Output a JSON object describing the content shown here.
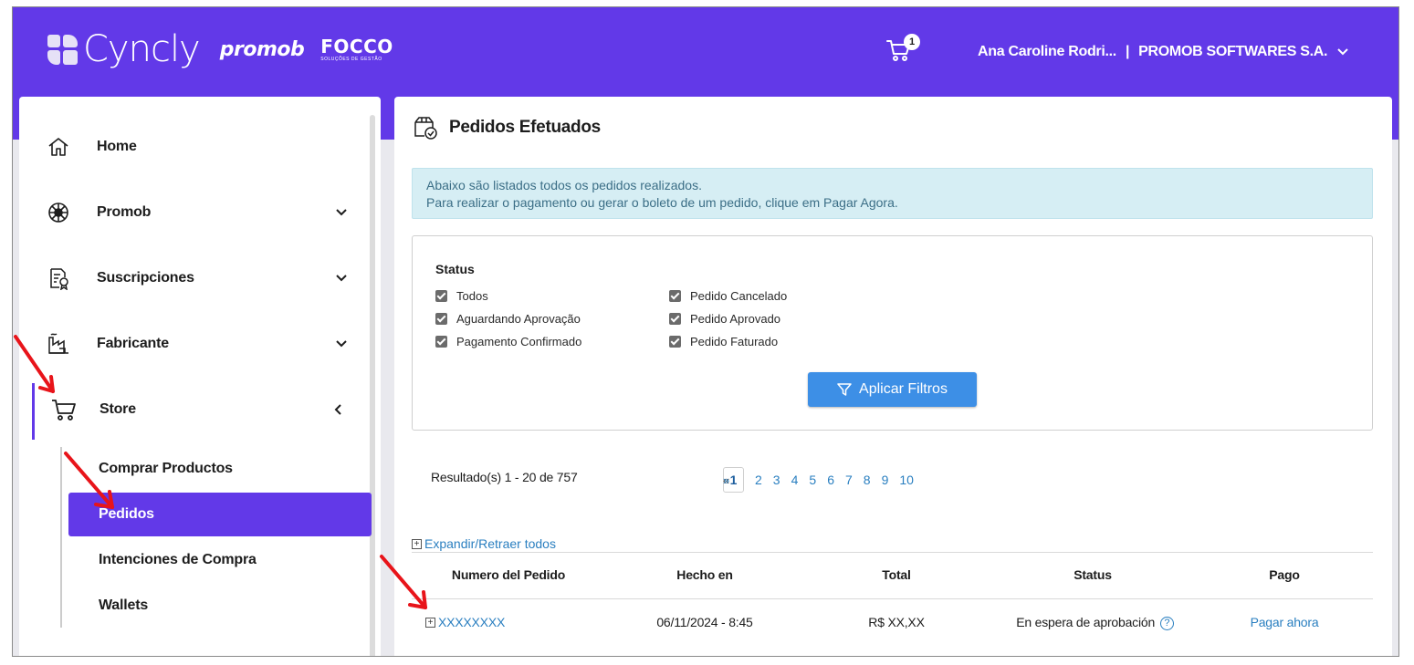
{
  "brand": {
    "cyncly": "Cyncly",
    "promob": "promob",
    "focco": "FOCCO",
    "focco_tagline": "SOLUÇÕES DE GESTÃO"
  },
  "header": {
    "cart_count": "1",
    "user_name": "Ana Caroline Rodri...",
    "separator": "|",
    "company": "PROMOB SOFTWARES S.A."
  },
  "sidebar": {
    "items": [
      {
        "label": "Home",
        "icon": "home-icon"
      },
      {
        "label": "Promob",
        "icon": "promob-icon"
      },
      {
        "label": "Suscripciones",
        "icon": "subscription-icon"
      },
      {
        "label": "Fabricante",
        "icon": "factory-icon"
      },
      {
        "label": "Store",
        "icon": "cart-icon"
      }
    ],
    "store_submenu": [
      {
        "label": "Comprar Productos"
      },
      {
        "label": "Pedidos",
        "active": true
      },
      {
        "label": "Intenciones de Compra"
      },
      {
        "label": "Wallets"
      }
    ]
  },
  "main": {
    "title": "Pedidos Efetuados",
    "info_line1": "Abaixo são listados todos os pedidos realizados.",
    "info_line2": "Para realizar o pagamento ou gerar o boleto de um pedido, clique em Pagar Agora.",
    "filter": {
      "status_label": "Status",
      "options": [
        {
          "label": "Todos",
          "checked": true
        },
        {
          "label": "Aguardando Aprovação",
          "checked": true
        },
        {
          "label": "Pagamento Confirmado",
          "checked": true
        },
        {
          "label": "Pedido Cancelado",
          "checked": true
        },
        {
          "label": "Pedido Aprovado",
          "checked": true
        },
        {
          "label": "Pedido Faturado",
          "checked": true
        }
      ],
      "apply_label": "Aplicar Filtros"
    },
    "results_text": "Resultado(s) 1 - 20 de 757",
    "pagination": {
      "prev": "«",
      "pages": [
        "1",
        "2",
        "3",
        "4",
        "5",
        "6",
        "7",
        "8",
        "9",
        "10"
      ],
      "current": "1",
      "next": "»"
    },
    "expand_all": "Expandir/Retraer todos",
    "table": {
      "headers": [
        "Numero del Pedido",
        "Hecho en",
        "Total",
        "Status",
        "Pago"
      ],
      "rows": [
        {
          "order": "XXXXXXXX",
          "date": "06/11/2024 - 8:45",
          "total": "R$ XX,XX",
          "status": "En espera de aprobación",
          "pay": "Pagar ahora"
        }
      ]
    }
  },
  "colors": {
    "brand_purple": "#6239e8",
    "button_blue": "#3d8fe6",
    "link_blue": "#2a7fc0",
    "info_bg": "#d6eef4",
    "annotation_red": "#e8141a"
  }
}
